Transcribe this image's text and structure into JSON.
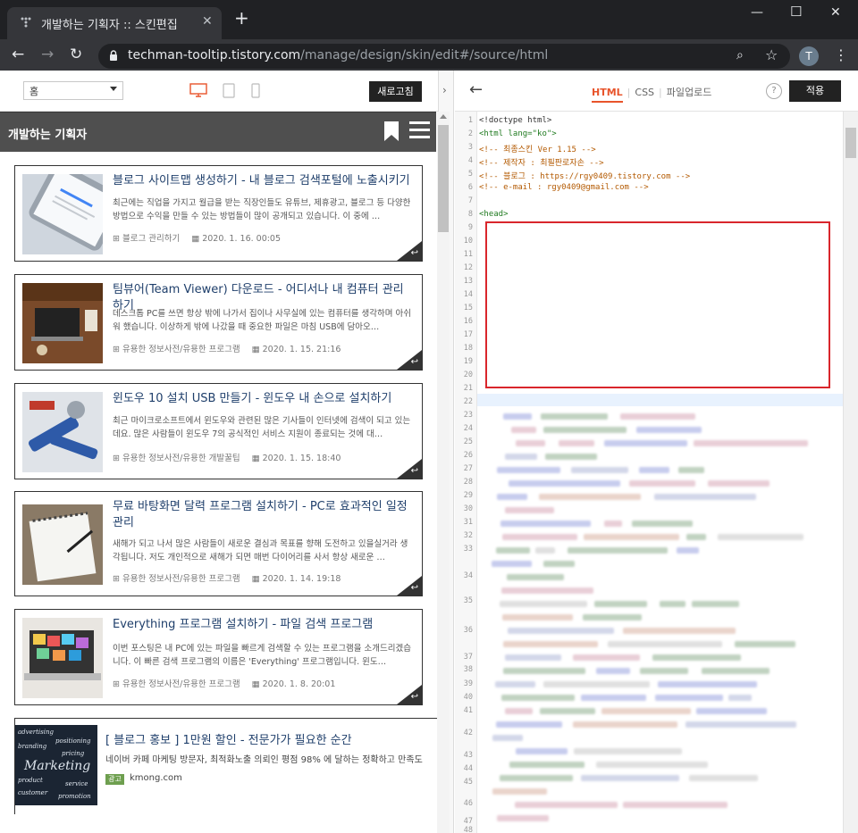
{
  "browser": {
    "tab_title": "개발하는 기획자 :: 스킨편집",
    "url_host": "techman-tooltip.tistory.com",
    "url_path": "/manage/design/skin/edit#/source/html",
    "avatar_letter": "T"
  },
  "left_toolbar": {
    "page_select": "홈",
    "refresh_label": "새로고침"
  },
  "blog": {
    "title": "개발하는 기획자",
    "posts": [
      {
        "title": "블로그 사이트맵 생성하기 - 내 블로그 검색포털에 노출시키기",
        "desc": "최근에는 직업을 가지고 월급을 받는 직장인들도 유튜브, 제휴광고, 블로그 등 다양한 방법으로 수익을 만들 수 있는 방법들이 많이 공개되고 있습니다. 이 중에 …",
        "category": "블로그 관리하기",
        "date": "2020. 1. 16. 00:05"
      },
      {
        "title": "팀뷰어(Team Viewer) 다운로드 - 어디서나 내 컴퓨터 관리하기",
        "desc": "데스크톱 PC를 쓰면 항상 밖에 나가서 집이나 사무실에 있는 컴퓨터를 생각하며 아쉬워 했습니다. 이상하게 밖에 나갔을 때 중요한 파일은 마침 USB에 담아오…",
        "category": "유용한 정보사전/유용한 프로그램",
        "date": "2020. 1. 15. 21:16"
      },
      {
        "title": "윈도우 10 설치 USB 만들기 - 윈도우 내 손으로 설치하기",
        "desc": "최근 마이크로소프트에서 윈도우와 관련된 많은 기사들이 인터넷에 검색이 되고 있는데요. 많은 사람들이 윈도우 7의 공식적인 서비스 지원이 종료되는 것에 대…",
        "category": "유용한 정보사전/유용한 개발꿀팁",
        "date": "2020. 1. 15. 18:40"
      },
      {
        "title": "무료 바탕화면 달력 프로그램 설치하기 - PC로 효과적인 일정 관리",
        "desc": "새해가 되고 나서 많은 사람들이 새로운 결심과 목표를 향해 도전하고 있을실거라 생각됩니다. 저도 개인적으로 새해가 되면 매번 다이어리를 사서 항상 새로운 …",
        "category": "유용한 정보사전/유용한 프로그램",
        "date": "2020. 1. 14. 19:18"
      },
      {
        "title": "Everything 프로그램 설치하기 - 파일 검색 프로그램",
        "desc": "이번 포스팅은 내 PC에 있는 파일을 빠르게 검색할 수 있는 프로그램을 소개드리겠습니다. 이 빠른 검색 프로그램의 이름은 'Everything' 프로그램입니다. 윈도…",
        "category": "유용한 정보사전/유용한 프로그램",
        "date": "2020. 1. 8. 20:01"
      }
    ],
    "ad": {
      "title": "[ 블로그 홍보 ] 1만원 할인 - 전문가가 필요한 순간",
      "body": "네이버 카페 마케팅 방문자, 최적화노출 의뢰인 평점 98% 에 달하는 정확하고 만족도",
      "tag": "광고",
      "source": "kmong.com",
      "image_words": [
        "advertising",
        "positioning",
        "branding",
        "pricing",
        "Marketing",
        "product",
        "service",
        "customer",
        "promotion"
      ]
    }
  },
  "editor": {
    "tabs": [
      "HTML",
      "CSS",
      "파일업로드"
    ],
    "active_tab": "HTML",
    "help": "?",
    "apply_label": "적용",
    "line_numbers": [
      "1",
      "2",
      "3",
      "4",
      "5",
      "6",
      "7",
      "8",
      "9",
      "10",
      "11",
      "12",
      "13",
      "14",
      "15",
      "16",
      "17",
      "18",
      "19",
      "20",
      "21",
      "22",
      "23",
      "24",
      "25",
      "26",
      "27",
      "28",
      "29",
      "30",
      "31",
      "32",
      "33",
      "34",
      "35",
      "36",
      "37",
      "38",
      "39",
      "40",
      "41",
      "42",
      "43",
      "44",
      "45",
      "46",
      "47",
      "48"
    ],
    "code_lines": [
      "<!doctype html>",
      "<html lang=\"ko\">",
      "<!-- 최종스킨 Ver 1.15 -->",
      "<!-- 제작자 : 최필판로자손 -->",
      "<!-- 블로그 : https://rgy0409.tistory.com -->",
      "<!-- e-mail : rgy0409@gmail.com -->",
      "",
      "<head>"
    ]
  },
  "colors": {
    "accent": "#e8542b",
    "highlight_box": "#d9262c",
    "title_blue": "#1f3f6b"
  }
}
